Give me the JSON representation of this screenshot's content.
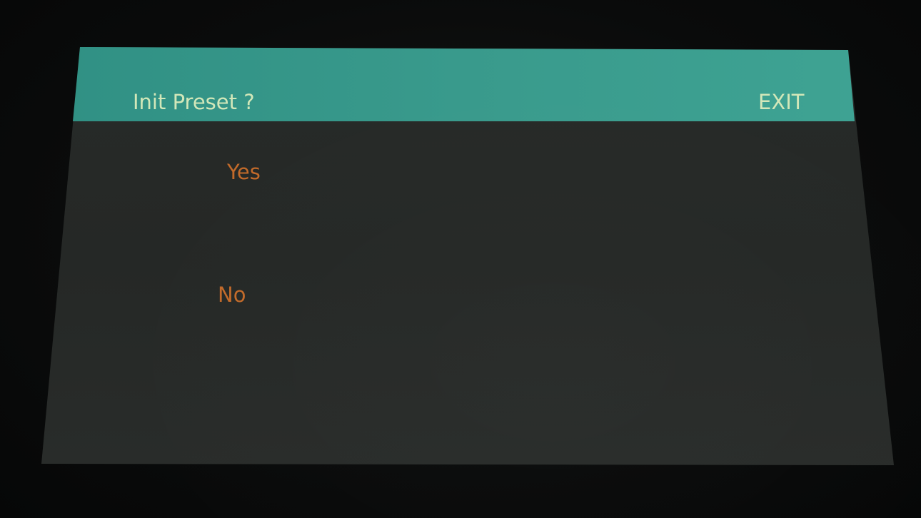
{
  "dialog": {
    "title": "Init Preset ?",
    "exit_label": "EXIT",
    "options": [
      {
        "label": "Yes"
      },
      {
        "label": "No"
      }
    ]
  },
  "colors": {
    "header_bg": "#3a9a8c",
    "header_text": "#d2e7b9",
    "screen_bg": "#262927",
    "option_text": "#c26a2a",
    "bezel": "#0b0c0c"
  }
}
